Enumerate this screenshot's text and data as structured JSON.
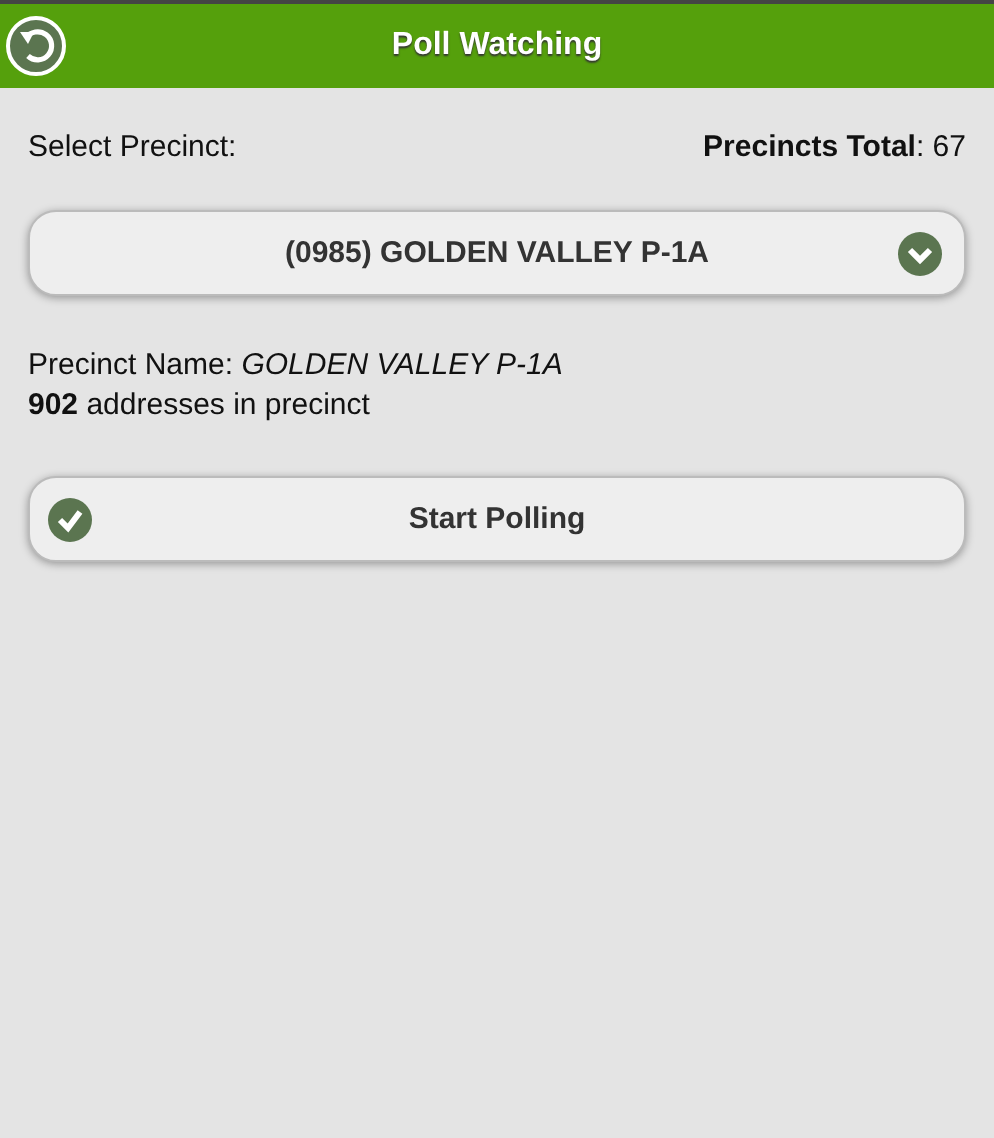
{
  "header": {
    "title": "Poll Watching"
  },
  "precinct_select": {
    "label": "Select Precinct:",
    "total": "**Precincts Total**: 67",
    "value": "(0985) GOLDEN VALLEY P-1A"
  },
  "info": [
    "Precinct Name: *GOLDEN VALLEY P-1A*",
    "**902** addresses in precinct"
  ],
  "start_button": {
    "label": "Start Polling"
  }
}
